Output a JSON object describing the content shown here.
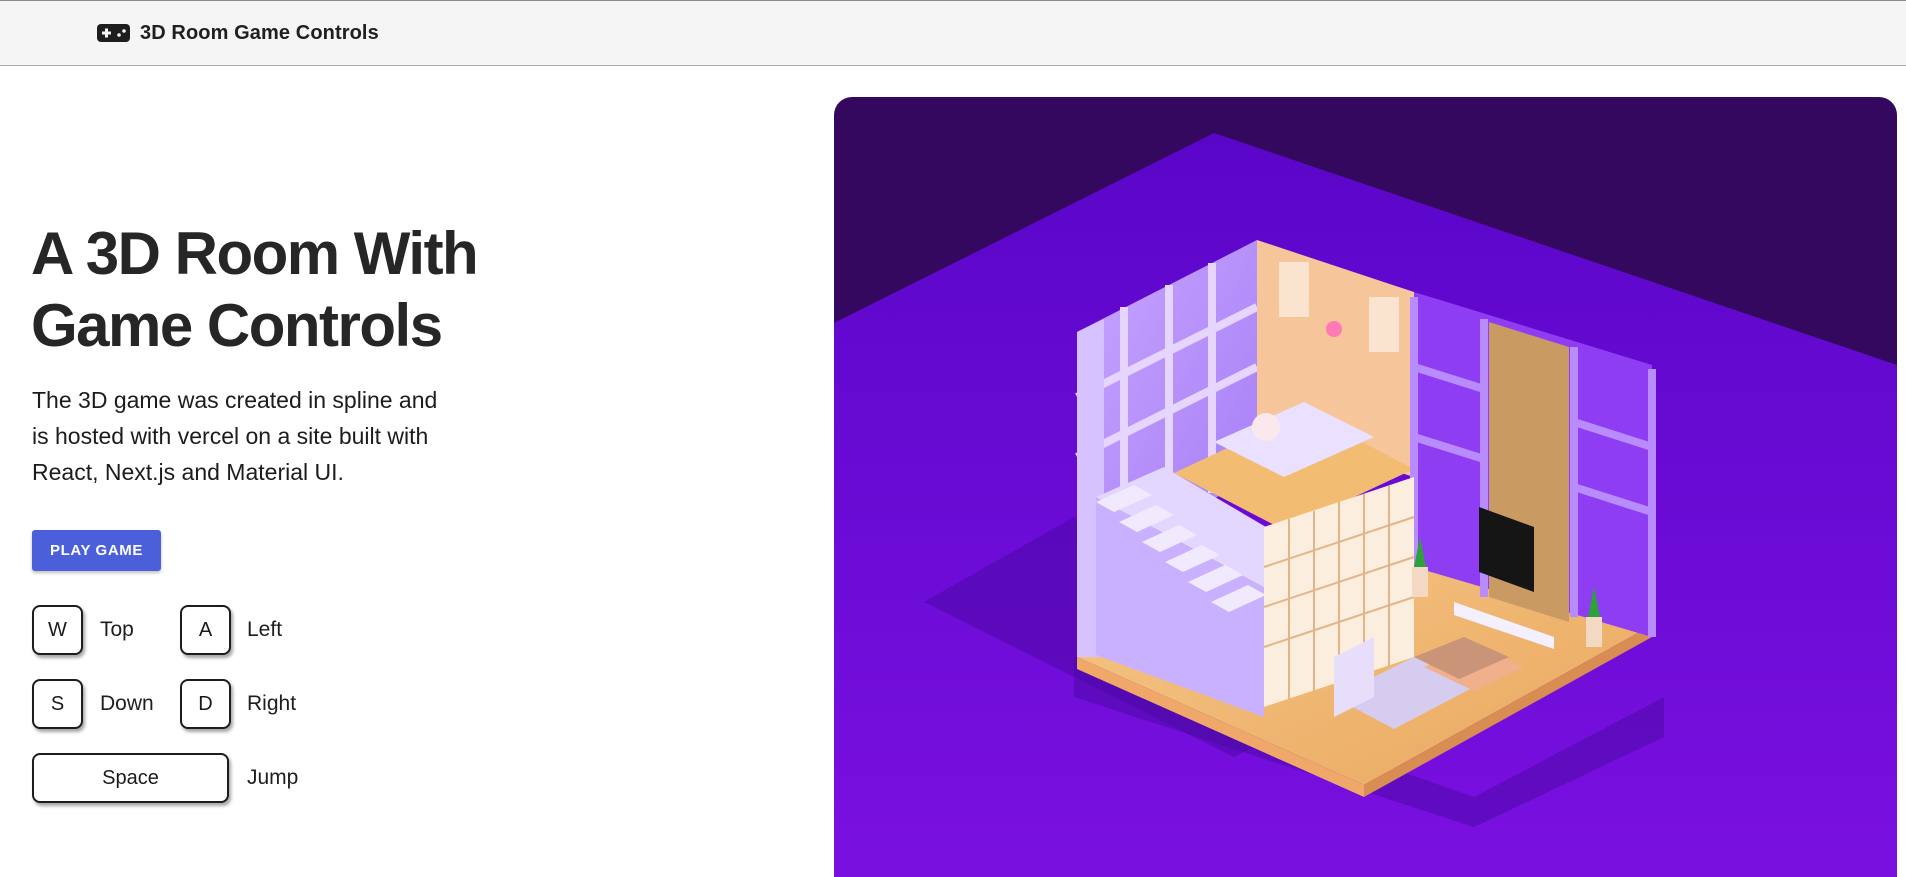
{
  "appbar": {
    "icon": "gamepad-icon",
    "title": "3D Room Game Controls"
  },
  "hero": {
    "title_line1": "A 3D Room With",
    "title_line2": "Game Controls",
    "description_line1": "The 3D game was created in spline and",
    "description_line2": "is hosted with vercel on a site built with",
    "description_line3": "React, Next.js and Material UI."
  },
  "play_button": {
    "label": "PLAY GAME",
    "color": "#4a5fd9"
  },
  "controls": [
    {
      "key": "W",
      "action": "Top"
    },
    {
      "key": "A",
      "action": "Left"
    },
    {
      "key": "S",
      "action": "Down"
    },
    {
      "key": "D",
      "action": "Right"
    },
    {
      "key": "Space",
      "action": "Jump"
    }
  ],
  "scene": {
    "background_top": "#34085f",
    "background_floor": "#6a0fd6",
    "accent_wall": "#b48cff"
  }
}
